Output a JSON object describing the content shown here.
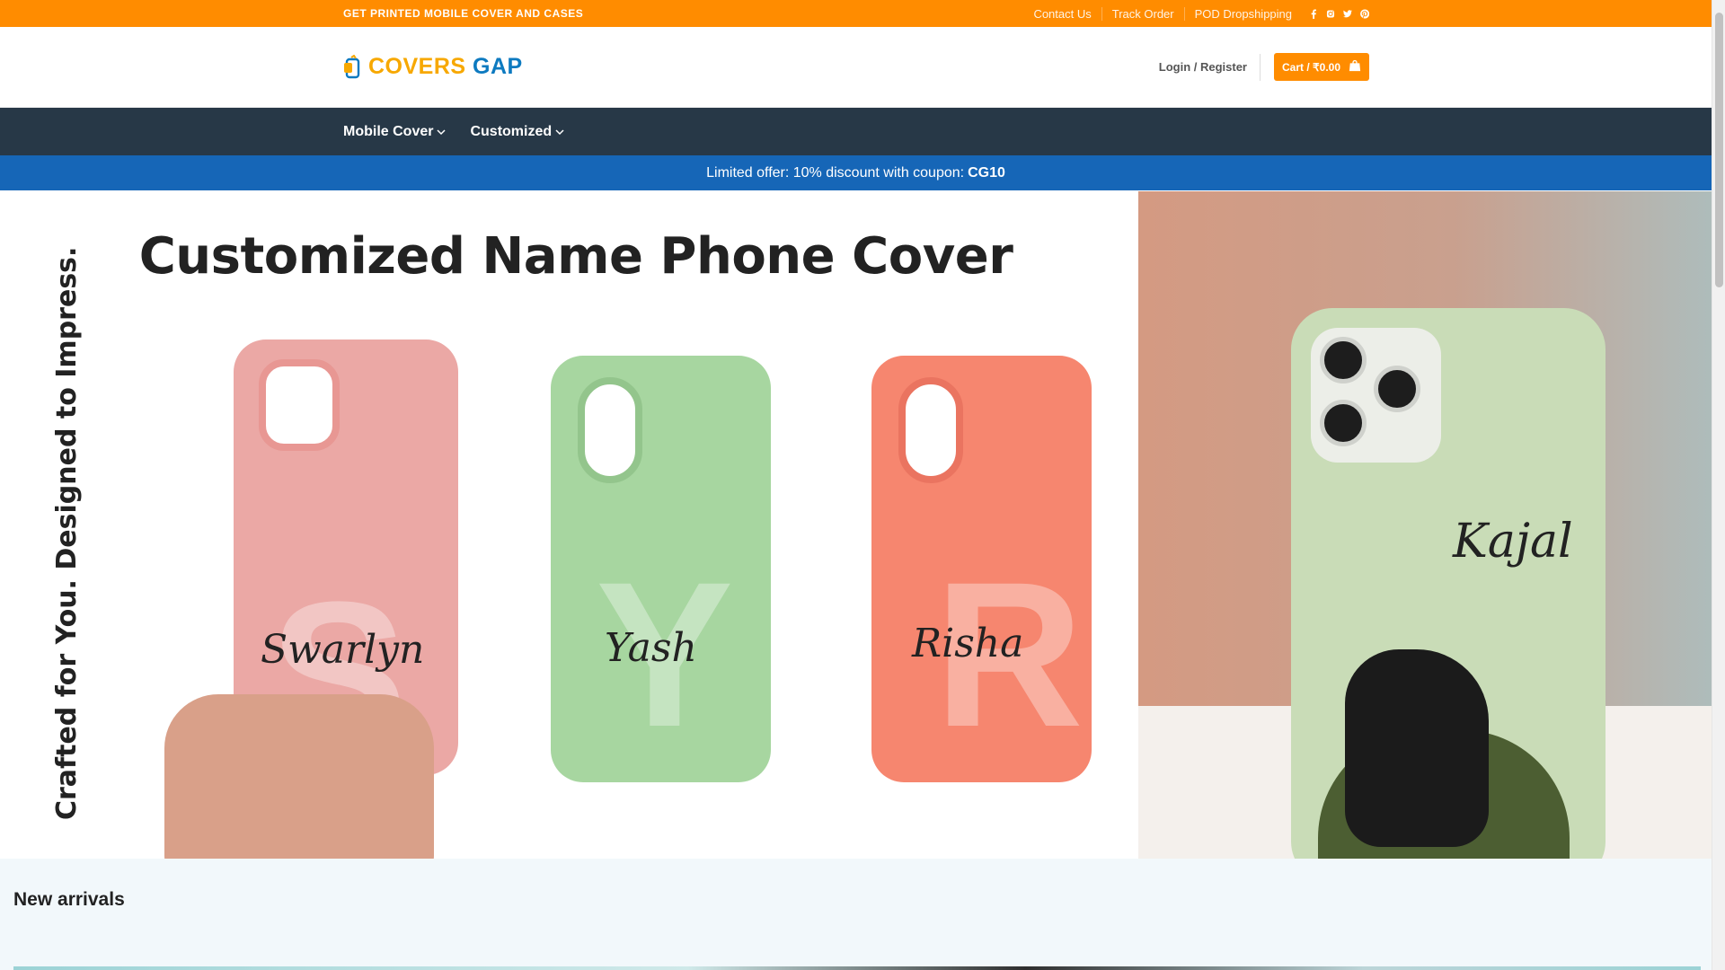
{
  "topbar": {
    "tagline": "GET PRINTED MOBILE COVER AND CASES",
    "links": [
      "Contact Us",
      "Track Order",
      "POD Dropshipping"
    ],
    "social_icons": [
      "facebook-icon",
      "instagram-icon",
      "twitter-icon",
      "pinterest-icon"
    ]
  },
  "header": {
    "logo_part1": "COVERS",
    "logo_part2": " GAP",
    "login_label": "Login / Register",
    "cart_label": "Cart / ₹0.00"
  },
  "nav": {
    "items": [
      "Mobile Cover",
      "Customized"
    ]
  },
  "promo": {
    "text": "Limited offer: 10% discount with coupon:",
    "coupon": "CG10"
  },
  "hero": {
    "title": "Customized Name Phone Cover",
    "vertical_text": "Crafted for You. Designed to Impress.",
    "names": [
      "Swarlyn",
      "Yash",
      "Risha",
      "Kajal"
    ],
    "letters": [
      "S",
      "Y",
      "R"
    ]
  },
  "section": {
    "new_arrivals": "New arrivals"
  },
  "colors": {
    "topbar": "#ff8c00",
    "nav": "#273847",
    "promo": "#1666b7",
    "cart": "#ff8c00"
  }
}
